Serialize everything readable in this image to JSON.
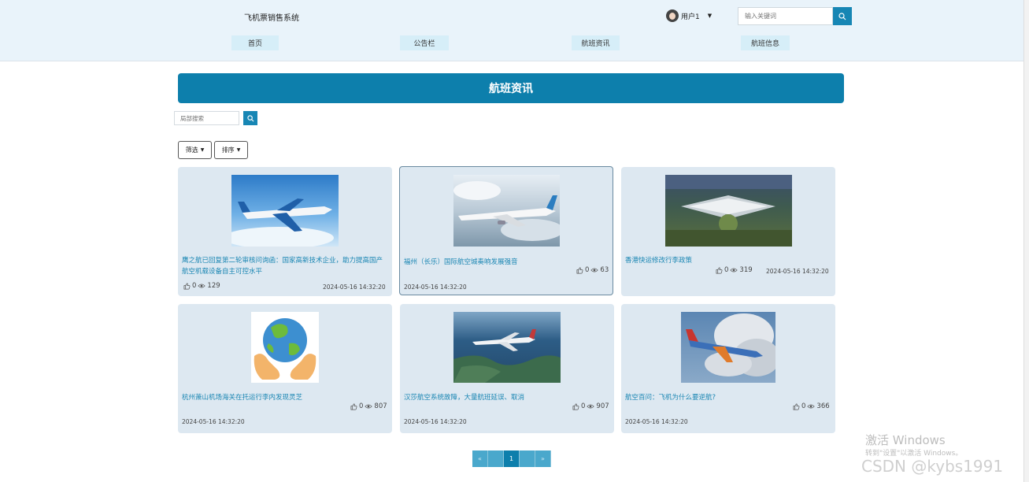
{
  "header": {
    "brand": "飞机票销售系统",
    "user_name": "用户1",
    "search_placeholder": "输入关键词"
  },
  "nav": [
    {
      "label": "首页"
    },
    {
      "label": "公告栏"
    },
    {
      "label": "航班资讯"
    },
    {
      "label": "航班信息"
    }
  ],
  "page": {
    "banner_title": "航班资讯",
    "local_search_placeholder": "局部搜索",
    "filter_label": "筛选",
    "sort_label": "排序"
  },
  "cards": [
    {
      "title": "鹰之航已回复第二轮审核问询函：国家高新技术企业，助力提高国产航空机载设备自主可控水平",
      "likes": "0",
      "views": "129",
      "date": "2024-05-16 14:32:20",
      "image": "cargo-airplane-sky"
    },
    {
      "title": "福州（长乐）国际航空城奏响发展强音",
      "likes": "0",
      "views": "63",
      "date": "2024-05-16 14:32:20",
      "image": "airliner-clouds"
    },
    {
      "title": "香港快运修改行李政策",
      "likes": "0",
      "views": "319",
      "date": "2024-05-16 14:32:20",
      "image": "airport-terminal-aerial"
    },
    {
      "title": "杭州萧山机场海关在托运行李内发现灵芝",
      "likes": "0",
      "views": "807",
      "date": "2024-05-16 14:32:20",
      "image": "globe-in-hands"
    },
    {
      "title": "汉莎航空系统故障，大量航班延误、取消",
      "likes": "0",
      "views": "907",
      "date": "2024-05-16 14:32:20",
      "image": "airplane-over-coast"
    },
    {
      "title": "航空百问：飞机为什么要逆航?",
      "likes": "0",
      "views": "366",
      "date": "2024-05-16 14:32:20",
      "image": "airplane-storm-clouds"
    }
  ],
  "pagination": {
    "prev": "«",
    "current": "1",
    "next": "»"
  },
  "watermark": {
    "line1": "激活 Windows",
    "line2": "转到\"设置\"以激活 Windows。",
    "csdn": "CSDN @kybs1991"
  },
  "colors": {
    "accent": "#0d7fac",
    "header_bg": "#e9f3fa",
    "card_bg": "#dde8f1",
    "title_link": "#1a86b3"
  }
}
